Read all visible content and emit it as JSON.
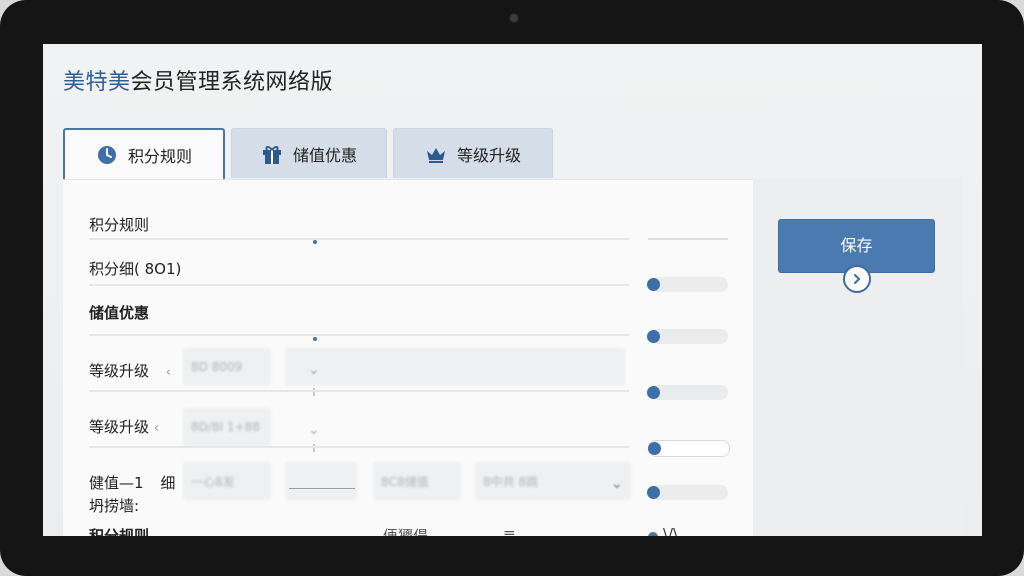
{
  "app": {
    "brand": "美特美",
    "title_rest": "会员管理系统网络版"
  },
  "tabs": [
    {
      "label": "积分规则",
      "icon": "clock-icon",
      "active": true
    },
    {
      "label": "储值优惠",
      "icon": "gift-icon",
      "active": false
    },
    {
      "label": "等级升级",
      "icon": "crown-icon",
      "active": false
    }
  ],
  "rows": {
    "r1": "积分规则",
    "r2": "积分细( 8O1)",
    "r3": "储值优惠",
    "r4": "等级升级",
    "r4_mark": "ﾠ‹",
    "r5": "等级升级",
    "r5_mark": "‹",
    "r6a": "健值—1",
    "r6b": "细",
    "r6c": "坍捞墙:",
    "r7": "积分规则",
    "r7_b": "侢獿偍",
    "r7_c": "≡",
    "r7_d": "\\/\\"
  },
  "blurred": {
    "f1": "8D 8009",
    "f2": "8D/8I 1+88",
    "f3": "一心8发",
    "f4": "8C8储值",
    "f5": "8中共 8跳"
  },
  "side": {
    "save_label": "保存",
    "save_icon": "chevron-right-icon"
  },
  "colors": {
    "accent": "#4a7ab0",
    "brand": "#2f5f9a",
    "tab_inactive": "#d5dee8"
  }
}
